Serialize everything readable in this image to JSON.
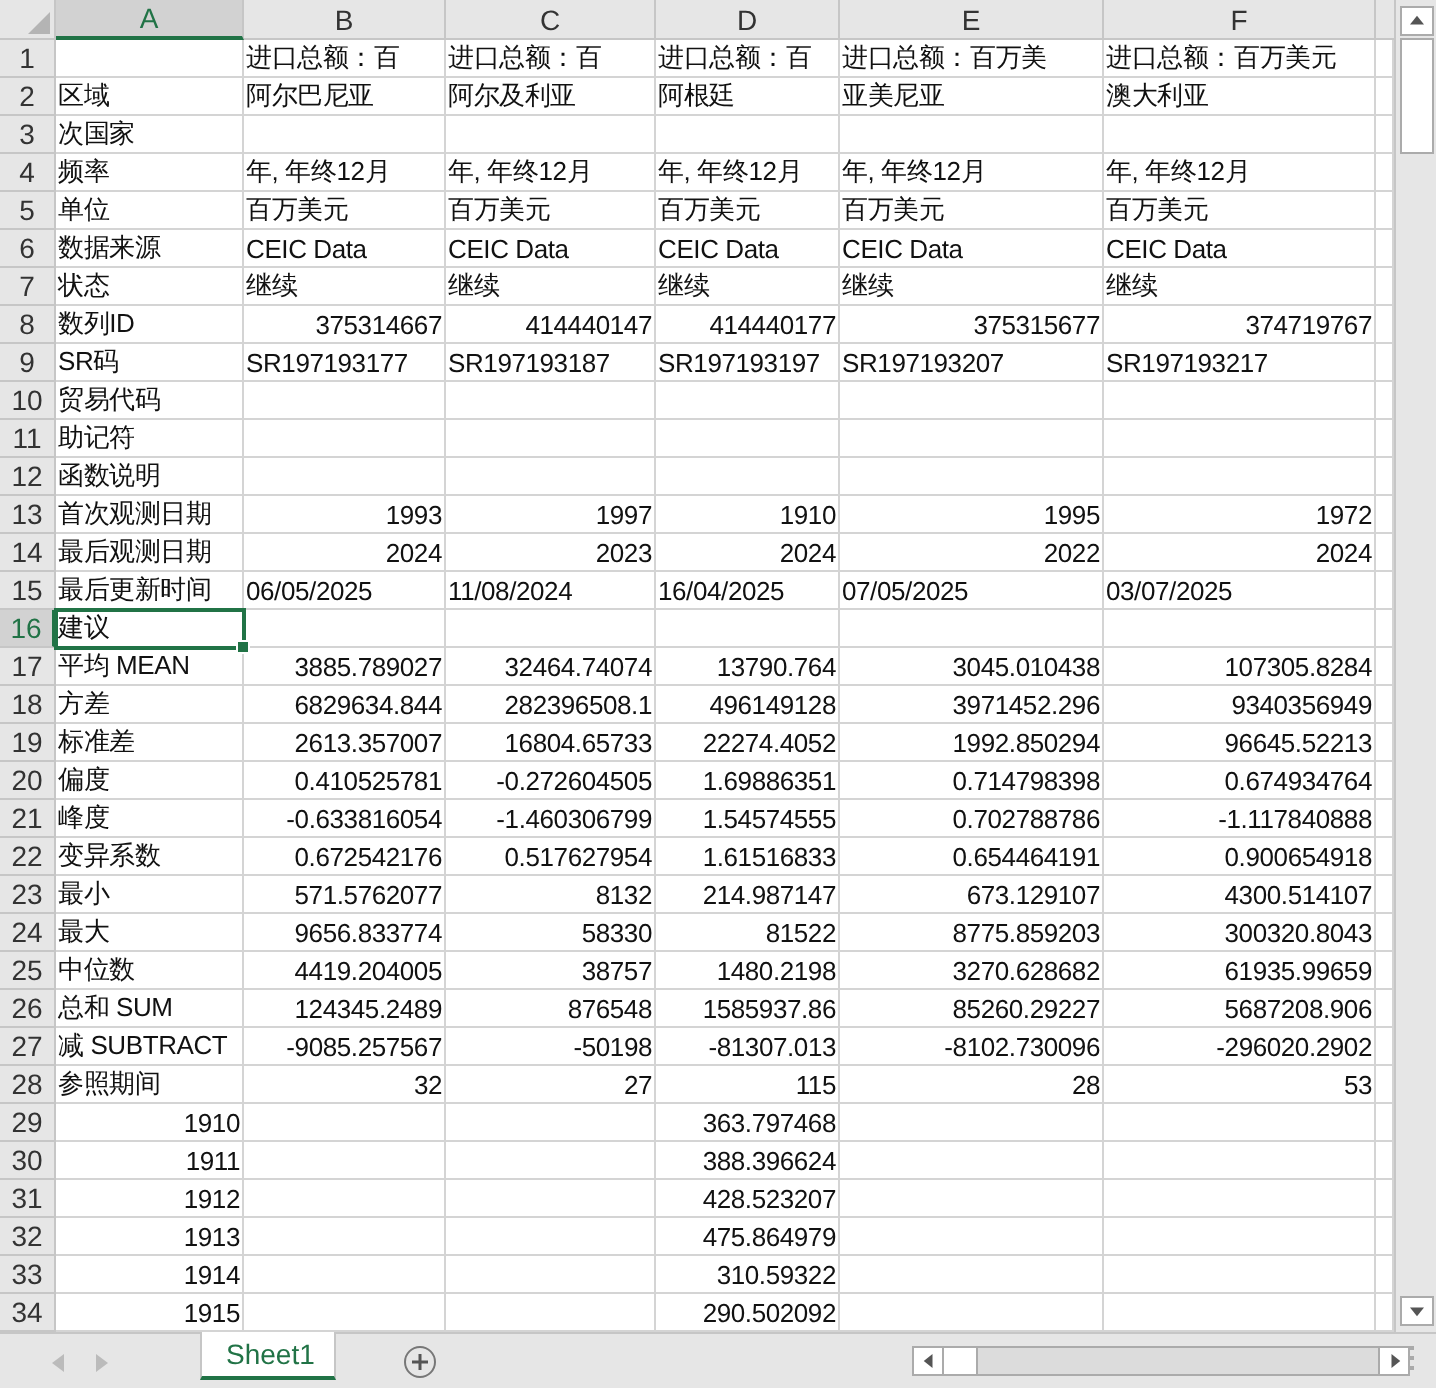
{
  "columns": [
    {
      "label": "A",
      "selected": true
    },
    {
      "label": "B",
      "selected": false
    },
    {
      "label": "C",
      "selected": false
    },
    {
      "label": "D",
      "selected": false
    },
    {
      "label": "E",
      "selected": false
    },
    {
      "label": "F",
      "selected": false
    }
  ],
  "rows": [
    {
      "number": "1",
      "selected": false,
      "cells": [
        null,
        {
          "text": "进口总额：百",
          "kind": "text"
        },
        {
          "text": "进口总额：百",
          "kind": "text"
        },
        {
          "text": "进口总额：百",
          "kind": "text"
        },
        {
          "text": "进口总额：百万美",
          "kind": "text"
        },
        {
          "text": "进口总额：百万美元",
          "kind": "text"
        }
      ]
    },
    {
      "number": "2",
      "selected": false,
      "cells": [
        {
          "text": "区域",
          "kind": "text"
        },
        {
          "text": "阿尔巴尼亚",
          "kind": "text"
        },
        {
          "text": "阿尔及利亚",
          "kind": "text"
        },
        {
          "text": "阿根廷",
          "kind": "text"
        },
        {
          "text": "亚美尼亚",
          "kind": "text"
        },
        {
          "text": "澳大利亚",
          "kind": "text"
        }
      ]
    },
    {
      "number": "3",
      "selected": false,
      "cells": [
        {
          "text": "次国家",
          "kind": "text"
        },
        null,
        null,
        null,
        null,
        null
      ]
    },
    {
      "number": "4",
      "selected": false,
      "cells": [
        {
          "text": "频率",
          "kind": "text"
        },
        {
          "text": "年, 年终12月",
          "kind": "text"
        },
        {
          "text": "年, 年终12月",
          "kind": "text"
        },
        {
          "text": "年, 年终12月",
          "kind": "text"
        },
        {
          "text": "年, 年终12月",
          "kind": "text"
        },
        {
          "text": "年, 年终12月",
          "kind": "text"
        }
      ]
    },
    {
      "number": "5",
      "selected": false,
      "cells": [
        {
          "text": "单位",
          "kind": "text"
        },
        {
          "text": "百万美元",
          "kind": "text"
        },
        {
          "text": "百万美元",
          "kind": "text"
        },
        {
          "text": "百万美元",
          "kind": "text"
        },
        {
          "text": "百万美元",
          "kind": "text"
        },
        {
          "text": "百万美元",
          "kind": "text"
        }
      ]
    },
    {
      "number": "6",
      "selected": false,
      "cells": [
        {
          "text": "数据来源",
          "kind": "text"
        },
        {
          "text": "CEIC Data",
          "kind": "text"
        },
        {
          "text": "CEIC Data",
          "kind": "text"
        },
        {
          "text": "CEIC Data",
          "kind": "text"
        },
        {
          "text": "CEIC Data",
          "kind": "text"
        },
        {
          "text": "CEIC Data",
          "kind": "text"
        }
      ]
    },
    {
      "number": "7",
      "selected": false,
      "cells": [
        {
          "text": "状态",
          "kind": "text"
        },
        {
          "text": "继续",
          "kind": "text"
        },
        {
          "text": "继续",
          "kind": "text"
        },
        {
          "text": "继续",
          "kind": "text"
        },
        {
          "text": "继续",
          "kind": "text"
        },
        {
          "text": "继续",
          "kind": "text"
        }
      ]
    },
    {
      "number": "8",
      "selected": false,
      "cells": [
        {
          "text": "数列ID",
          "kind": "text"
        },
        {
          "text": "375314667",
          "kind": "number"
        },
        {
          "text": "414440147",
          "kind": "number"
        },
        {
          "text": "414440177",
          "kind": "number"
        },
        {
          "text": "375315677",
          "kind": "number"
        },
        {
          "text": "374719767",
          "kind": "number"
        }
      ]
    },
    {
      "number": "9",
      "selected": false,
      "cells": [
        {
          "text": "SR码",
          "kind": "text"
        },
        {
          "text": "SR197193177",
          "kind": "text"
        },
        {
          "text": "SR197193187",
          "kind": "text"
        },
        {
          "text": "SR197193197",
          "kind": "text"
        },
        {
          "text": "SR197193207",
          "kind": "text"
        },
        {
          "text": "SR197193217",
          "kind": "text"
        }
      ]
    },
    {
      "number": "10",
      "selected": false,
      "cells": [
        {
          "text": "贸易代码",
          "kind": "text"
        },
        null,
        null,
        null,
        null,
        null
      ]
    },
    {
      "number": "11",
      "selected": false,
      "cells": [
        {
          "text": "助记符",
          "kind": "text"
        },
        null,
        null,
        null,
        null,
        null
      ]
    },
    {
      "number": "12",
      "selected": false,
      "cells": [
        {
          "text": "函数说明",
          "kind": "text"
        },
        null,
        null,
        null,
        null,
        null
      ]
    },
    {
      "number": "13",
      "selected": false,
      "cells": [
        {
          "text": "首次观测日期",
          "kind": "text"
        },
        {
          "text": "1993",
          "kind": "number"
        },
        {
          "text": "1997",
          "kind": "number"
        },
        {
          "text": "1910",
          "kind": "number"
        },
        {
          "text": "1995",
          "kind": "number"
        },
        {
          "text": "1972",
          "kind": "number"
        }
      ]
    },
    {
      "number": "14",
      "selected": false,
      "cells": [
        {
          "text": "最后观测日期",
          "kind": "text"
        },
        {
          "text": "2024",
          "kind": "number"
        },
        {
          "text": "2023",
          "kind": "number"
        },
        {
          "text": "2024",
          "kind": "number"
        },
        {
          "text": "2022",
          "kind": "number"
        },
        {
          "text": "2024",
          "kind": "number"
        }
      ]
    },
    {
      "number": "15",
      "selected": false,
      "cells": [
        {
          "text": "最后更新时间",
          "kind": "text"
        },
        {
          "text": "06/05/2025",
          "kind": "text"
        },
        {
          "text": "11/08/2024",
          "kind": "text"
        },
        {
          "text": "16/04/2025",
          "kind": "text"
        },
        {
          "text": "07/05/2025",
          "kind": "text"
        },
        {
          "text": "03/07/2025",
          "kind": "text"
        }
      ]
    },
    {
      "number": "16",
      "selected": true,
      "cells": [
        {
          "text": "建议",
          "kind": "text"
        },
        null,
        null,
        null,
        null,
        null
      ]
    },
    {
      "number": "17",
      "selected": false,
      "cells": [
        {
          "text": "平均 MEAN",
          "kind": "text"
        },
        {
          "text": "3885.789027",
          "kind": "number"
        },
        {
          "text": "32464.74074",
          "kind": "number"
        },
        {
          "text": "13790.764",
          "kind": "number"
        },
        {
          "text": "3045.010438",
          "kind": "number"
        },
        {
          "text": "107305.8284",
          "kind": "number"
        }
      ]
    },
    {
      "number": "18",
      "selected": false,
      "cells": [
        {
          "text": "方差",
          "kind": "text"
        },
        {
          "text": "6829634.844",
          "kind": "number"
        },
        {
          "text": "282396508.1",
          "kind": "number"
        },
        {
          "text": "496149128",
          "kind": "number"
        },
        {
          "text": "3971452.296",
          "kind": "number"
        },
        {
          "text": "9340356949",
          "kind": "number"
        }
      ]
    },
    {
      "number": "19",
      "selected": false,
      "cells": [
        {
          "text": "标准差",
          "kind": "text"
        },
        {
          "text": "2613.357007",
          "kind": "number"
        },
        {
          "text": "16804.65733",
          "kind": "number"
        },
        {
          "text": "22274.4052",
          "kind": "number"
        },
        {
          "text": "1992.850294",
          "kind": "number"
        },
        {
          "text": "96645.52213",
          "kind": "number"
        }
      ]
    },
    {
      "number": "20",
      "selected": false,
      "cells": [
        {
          "text": "偏度",
          "kind": "text"
        },
        {
          "text": "0.410525781",
          "kind": "number"
        },
        {
          "text": "-0.272604505",
          "kind": "number"
        },
        {
          "text": "1.69886351",
          "kind": "number"
        },
        {
          "text": "0.714798398",
          "kind": "number"
        },
        {
          "text": "0.674934764",
          "kind": "number"
        }
      ]
    },
    {
      "number": "21",
      "selected": false,
      "cells": [
        {
          "text": "峰度",
          "kind": "text"
        },
        {
          "text": "-0.633816054",
          "kind": "number"
        },
        {
          "text": "-1.460306799",
          "kind": "number"
        },
        {
          "text": "1.54574555",
          "kind": "number"
        },
        {
          "text": "0.702788786",
          "kind": "number"
        },
        {
          "text": "-1.117840888",
          "kind": "number"
        }
      ]
    },
    {
      "number": "22",
      "selected": false,
      "cells": [
        {
          "text": "变异系数",
          "kind": "text"
        },
        {
          "text": "0.672542176",
          "kind": "number"
        },
        {
          "text": "0.517627954",
          "kind": "number"
        },
        {
          "text": "1.61516833",
          "kind": "number"
        },
        {
          "text": "0.654464191",
          "kind": "number"
        },
        {
          "text": "0.900654918",
          "kind": "number"
        }
      ]
    },
    {
      "number": "23",
      "selected": false,
      "cells": [
        {
          "text": "最小",
          "kind": "text"
        },
        {
          "text": "571.5762077",
          "kind": "number"
        },
        {
          "text": "8132",
          "kind": "number"
        },
        {
          "text": "214.987147",
          "kind": "number"
        },
        {
          "text": "673.129107",
          "kind": "number"
        },
        {
          "text": "4300.514107",
          "kind": "number"
        }
      ]
    },
    {
      "number": "24",
      "selected": false,
      "cells": [
        {
          "text": "最大",
          "kind": "text"
        },
        {
          "text": "9656.833774",
          "kind": "number"
        },
        {
          "text": "58330",
          "kind": "number"
        },
        {
          "text": "81522",
          "kind": "number"
        },
        {
          "text": "8775.859203",
          "kind": "number"
        },
        {
          "text": "300320.8043",
          "kind": "number"
        }
      ]
    },
    {
      "number": "25",
      "selected": false,
      "cells": [
        {
          "text": "中位数",
          "kind": "text"
        },
        {
          "text": "4419.204005",
          "kind": "number"
        },
        {
          "text": "38757",
          "kind": "number"
        },
        {
          "text": "1480.2198",
          "kind": "number"
        },
        {
          "text": "3270.628682",
          "kind": "number"
        },
        {
          "text": "61935.99659",
          "kind": "number"
        }
      ]
    },
    {
      "number": "26",
      "selected": false,
      "cells": [
        {
          "text": "总和 SUM",
          "kind": "text"
        },
        {
          "text": "124345.2489",
          "kind": "number"
        },
        {
          "text": "876548",
          "kind": "number"
        },
        {
          "text": "1585937.86",
          "kind": "number"
        },
        {
          "text": "85260.29227",
          "kind": "number"
        },
        {
          "text": "5687208.906",
          "kind": "number"
        }
      ]
    },
    {
      "number": "27",
      "selected": false,
      "cells": [
        {
          "text": "减 SUBTRACT",
          "kind": "text"
        },
        {
          "text": "-9085.257567",
          "kind": "number"
        },
        {
          "text": "-50198",
          "kind": "number"
        },
        {
          "text": "-81307.013",
          "kind": "number"
        },
        {
          "text": "-8102.730096",
          "kind": "number"
        },
        {
          "text": "-296020.2902",
          "kind": "number"
        }
      ]
    },
    {
      "number": "28",
      "selected": false,
      "cells": [
        {
          "text": "参照期间",
          "kind": "text"
        },
        {
          "text": "32",
          "kind": "number"
        },
        {
          "text": "27",
          "kind": "number"
        },
        {
          "text": "115",
          "kind": "number"
        },
        {
          "text": "28",
          "kind": "number"
        },
        {
          "text": "53",
          "kind": "number"
        }
      ]
    },
    {
      "number": "29",
      "selected": false,
      "cells": [
        {
          "text": "1910",
          "kind": "number"
        },
        null,
        null,
        {
          "text": "363.797468",
          "kind": "number"
        },
        null,
        null
      ]
    },
    {
      "number": "30",
      "selected": false,
      "cells": [
        {
          "text": "1911",
          "kind": "number"
        },
        null,
        null,
        {
          "text": "388.396624",
          "kind": "number"
        },
        null,
        null
      ]
    },
    {
      "number": "31",
      "selected": false,
      "cells": [
        {
          "text": "1912",
          "kind": "number"
        },
        null,
        null,
        {
          "text": "428.523207",
          "kind": "number"
        },
        null,
        null
      ]
    },
    {
      "number": "32",
      "selected": false,
      "cells": [
        {
          "text": "1913",
          "kind": "number"
        },
        null,
        null,
        {
          "text": "475.864979",
          "kind": "number"
        },
        null,
        null
      ]
    },
    {
      "number": "33",
      "selected": false,
      "cells": [
        {
          "text": "1914",
          "kind": "number"
        },
        null,
        null,
        {
          "text": "310.59322",
          "kind": "number"
        },
        null,
        null
      ]
    },
    {
      "number": "34",
      "selected": false,
      "cells": [
        {
          "text": "1915",
          "kind": "number"
        },
        null,
        null,
        {
          "text": "290.502092",
          "kind": "number"
        },
        null,
        null
      ]
    }
  ],
  "sheet_tabs": [
    {
      "label": "Sheet1",
      "selected": true
    }
  ]
}
